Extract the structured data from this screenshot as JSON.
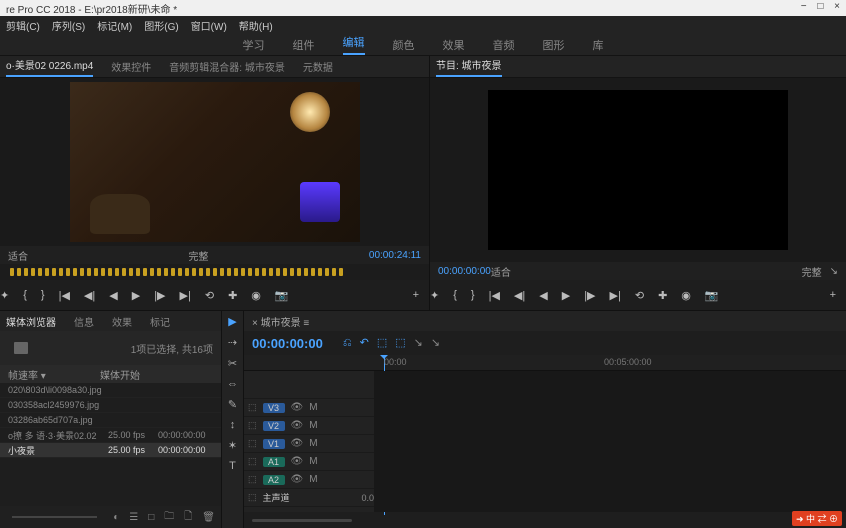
{
  "titlebar": {
    "title": "re Pro CC 2018 - E:\\pr2018新研\\未命 *",
    "min": "−",
    "max": "□",
    "close": "×"
  },
  "menubar": [
    "剪辑(C)",
    "序列(S)",
    "标记(M)",
    "图形(G)",
    "窗口(W)",
    "帮助(H)"
  ],
  "workspaces": [
    {
      "label": "学习",
      "active": false
    },
    {
      "label": "组件",
      "active": false
    },
    {
      "label": "编辑",
      "active": true
    },
    {
      "label": "颜色",
      "active": false
    },
    {
      "label": "效果",
      "active": false
    },
    {
      "label": "音频",
      "active": false
    },
    {
      "label": "图形",
      "active": false
    },
    {
      "label": "库",
      "active": false
    }
  ],
  "source": {
    "tabs": [
      {
        "label": "o·美景02 0226.mp4",
        "active": true
      },
      {
        "label": "效果控件",
        "active": false
      },
      {
        "label": "音频剪辑混合器: 城市夜景",
        "active": false
      },
      {
        "label": "元数据",
        "active": false
      }
    ],
    "fit": "适合",
    "tc": "00:00:24:11",
    "full": "完整"
  },
  "program": {
    "tab": "节目: 城市夜景",
    "tc": "00:00:00:00",
    "fit": "适合",
    "full": "完整"
  },
  "transport_icons": [
    "✦",
    "{",
    "}",
    "|◀",
    "◀|",
    "◀",
    "▶",
    "|▶",
    "▶|",
    "⟲",
    "✚",
    "◉",
    "📷"
  ],
  "project": {
    "tabs": [
      {
        "label": "媒体浏览器",
        "active": true
      },
      {
        "label": "信息",
        "active": false
      },
      {
        "label": "效果",
        "active": false
      },
      {
        "label": "标记",
        "active": false
      }
    ],
    "status": "1项已选择, 共16项",
    "col1": "帧速率 ▾",
    "col2": "媒体开始",
    "items": [
      {
        "name": "020\\803d\\li0098a30.jpg",
        "fr": "",
        "start": "",
        "sel": false
      },
      {
        "name": "030358acl2459976.jpg",
        "fr": "",
        "start": "",
        "sel": false
      },
      {
        "name": "03286ab65d707a.jpg",
        "fr": "",
        "start": "",
        "sel": false
      },
      {
        "name": "o撩 多 语·3·美景02.02",
        "fr": "25.00 fps",
        "start": "00:00:00:00",
        "sel": false
      },
      {
        "name": "小夜景",
        "fr": "25.00 fps",
        "start": "00:00:00:00",
        "sel": true
      }
    ],
    "bottom_icons": [
      "◐",
      "☰",
      "□",
      "🗀",
      "🗋",
      "🗑"
    ]
  },
  "tools": [
    "▶",
    "⇢",
    "✂",
    "⇔",
    "✎",
    "↕",
    "✶",
    "T"
  ],
  "timeline": {
    "tab": "× 城市夜景 ≡",
    "tc": "00:00:00:00",
    "head_icons": [
      "⎌",
      "↶",
      "⬚",
      "⬚",
      "↘",
      "↘"
    ],
    "ruler": [
      {
        "pos": 140,
        "label": "00:00"
      },
      {
        "pos": 360,
        "label": "00:05:00:00"
      }
    ],
    "vtracks": [
      "V3",
      "V2",
      "V1"
    ],
    "atracks": [
      "A1",
      "A2"
    ],
    "master": "主声道",
    "master_val": "0.0"
  },
  "watermark": "➜ 中 ⇄ ⊕"
}
